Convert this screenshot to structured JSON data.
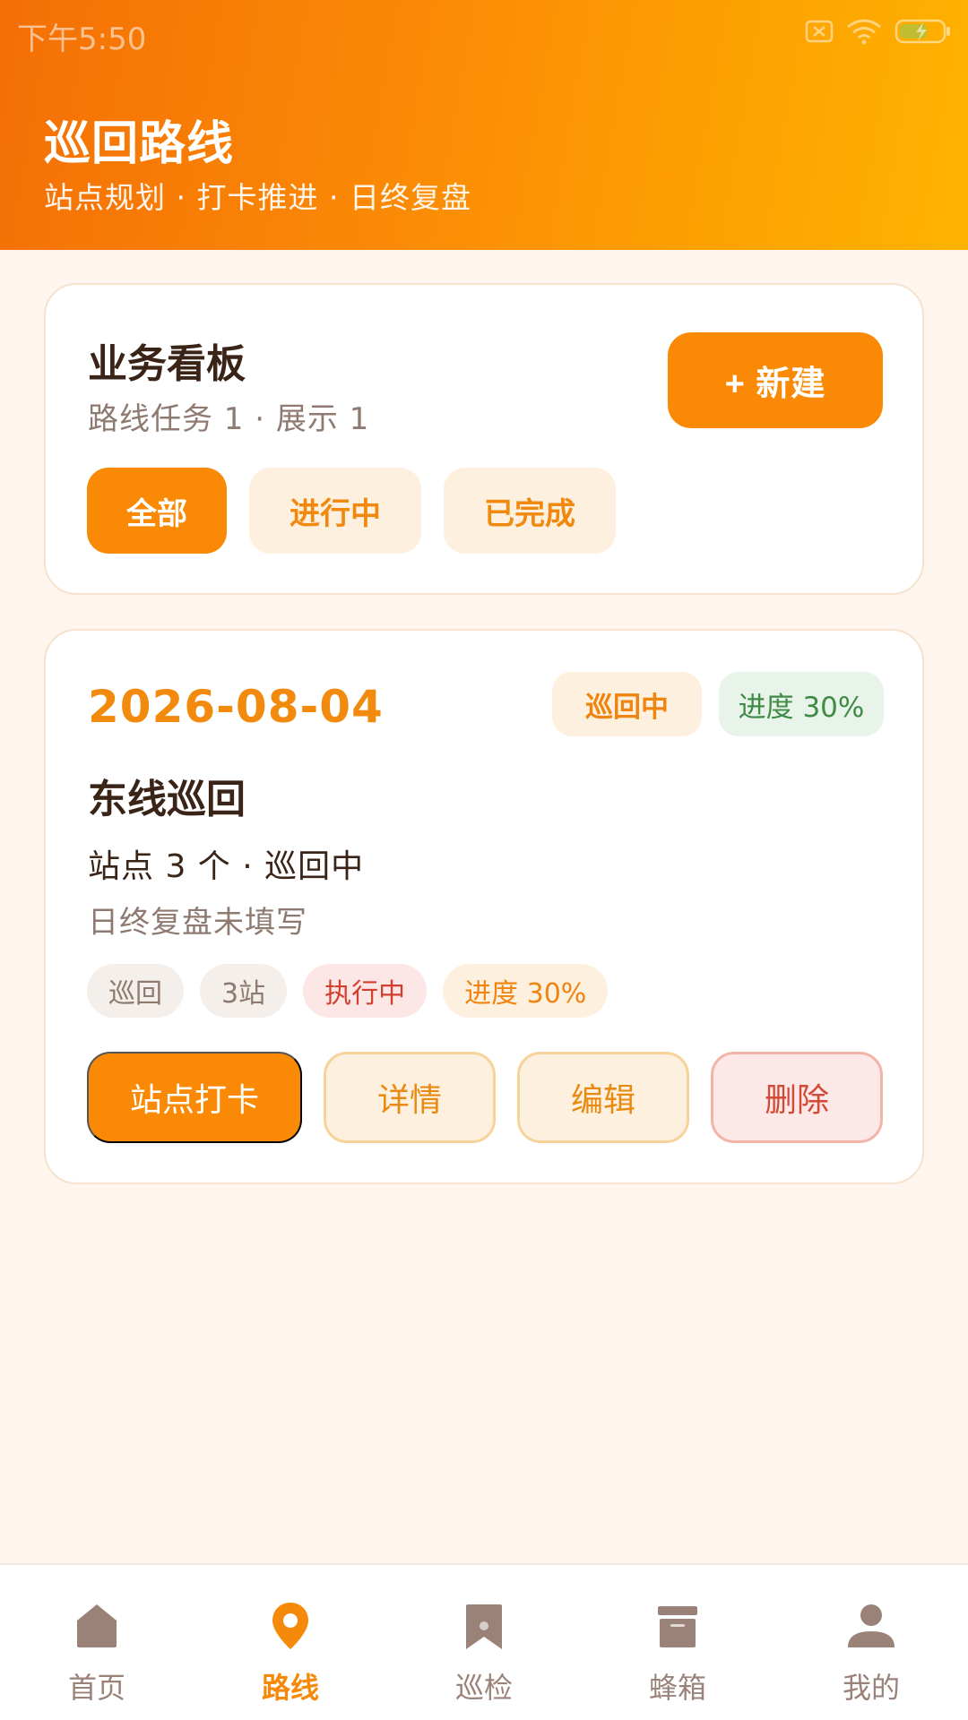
{
  "status_bar": {
    "time": "下午5:50"
  },
  "header": {
    "title": "巡回路线",
    "subtitle": "站点规划 · 打卡推进 · 日终复盘"
  },
  "board": {
    "title": "业务看板",
    "summary": "路线任务 1 · 展示 1",
    "new_button_label": "+ 新建",
    "filters": [
      {
        "label": "全部",
        "active": true
      },
      {
        "label": "进行中",
        "active": false
      },
      {
        "label": "已完成",
        "active": false
      }
    ]
  },
  "route": {
    "date": "2026-08-04",
    "status_badge": "巡回中",
    "progress_badge": "进度 30%",
    "progress": 0.3,
    "name": "东线巡回",
    "meta": "站点 3 个 · 巡回中",
    "review": "日终复盘未填写",
    "tags": [
      "巡回",
      "3站",
      "执行中",
      "进度 30%"
    ],
    "actions": {
      "checkin": "站点打卡",
      "details": "详情",
      "edit": "编辑",
      "delete": "删除"
    }
  },
  "nav": {
    "items": [
      {
        "label": "首页",
        "icon": "home-icon",
        "active": false
      },
      {
        "label": "路线",
        "icon": "location-pin-icon",
        "active": true
      },
      {
        "label": "巡检",
        "icon": "bookmark-icon",
        "active": false
      },
      {
        "label": "蜂箱",
        "icon": "box-icon",
        "active": false
      },
      {
        "label": "我的",
        "icon": "user-icon",
        "active": false
      }
    ]
  },
  "colors": {
    "accent": "#FA8A05",
    "header_gradient_start": "#F46F07",
    "header_gradient_end": "#FFB300",
    "background": "#FEF6EE",
    "nav_inactive": "#9A8278",
    "progress_green": "#3F8A45",
    "danger": "#D24A35"
  }
}
